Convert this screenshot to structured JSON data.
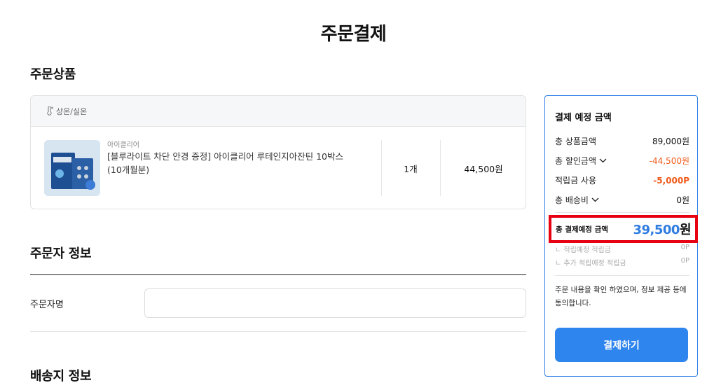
{
  "page": {
    "title": "주문결제"
  },
  "sections": {
    "order_items": "주문상품",
    "orderer_info": "주문자 정보",
    "shipping_info": "배송지 정보"
  },
  "product_card": {
    "storage_label": "상온/실온",
    "storage_icon": "thermometer-icon",
    "brand": "아이클리어",
    "name": "[블루라이트 차단 안경 증정] 아이클리어 루테인지아잔틴 10박스 (10개월분)",
    "quantity": "1개",
    "price": "44,500원"
  },
  "orderer": {
    "name_label": "주문자명",
    "name_value": "",
    "name_placeholder": ""
  },
  "summary": {
    "title": "결제 예정 금액",
    "product_total_label": "총 상품금액",
    "product_total_value": "89,000원",
    "discount_label": "총 할인금액",
    "discount_value": "-44,500원",
    "points_label": "적립금 사용",
    "points_value": "-5,000P",
    "shipping_label": "총 배송비",
    "shipping_value": "0원",
    "total_label": "총 결제예정 금액",
    "total_amount": "39,500",
    "total_unit": "원",
    "earn_label": "ㄴ 적립예정 적립금",
    "earn_value": "0P",
    "extra_earn_label": "ㄴ 추가 적립예정 적립금",
    "extra_earn_value": "0P",
    "agree_text": "주문 내용을 확인 하였으며, 정보 제공 등에 동의합니다.",
    "pay_button": "결제하기"
  },
  "colors": {
    "accent_blue": "#2f85ee",
    "discount_orange": "#f05a1a",
    "highlight_red": "#e60012"
  }
}
